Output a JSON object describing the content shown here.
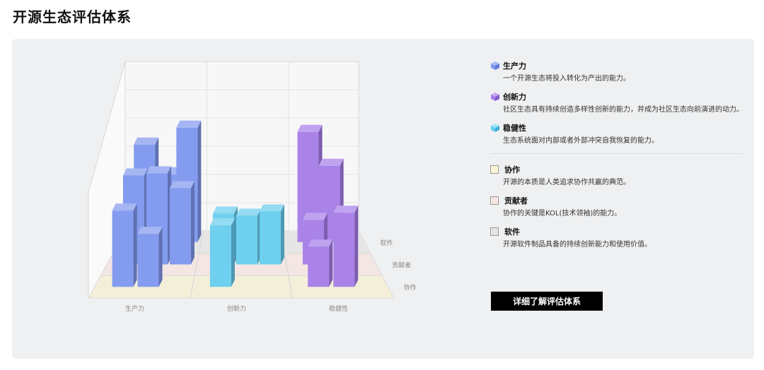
{
  "page": {
    "title": "开源生态评估体系"
  },
  "legend": {
    "dimensions": [
      {
        "label": "生产力",
        "desc": "一个开源生态将投入转化为产出的能力。",
        "color": "#7e97ee",
        "icon": "cube-icon"
      },
      {
        "label": "创新力",
        "desc": "社区生态具有持续创造多样性创新的能力，并成为社区生态向前演进的动力。",
        "color": "#a57ce8",
        "icon": "cube-icon"
      },
      {
        "label": "稳健性",
        "desc": "生态系统面对内部或者外部冲突自我恢复的能力。",
        "color": "#66ccee",
        "icon": "cube-icon"
      }
    ],
    "layers": [
      {
        "label": "协作",
        "desc": "开源的本质是人类追求协作共赢的典范。",
        "color": "#fbf3d6",
        "icon": "square-icon"
      },
      {
        "label": "贡献者",
        "desc": "协作的关键是KOL(技术领袖)的能力。",
        "color": "#f5e6e1",
        "icon": "square-icon"
      },
      {
        "label": "软件",
        "desc": "开源软件制品具备的持续创新能力和使用价值。",
        "color": "#e4e4e4",
        "icon": "square-icon"
      }
    ]
  },
  "cta": {
    "label": "详细了解评估体系"
  },
  "chart_data": {
    "type": "bar3d",
    "x_categories": [
      "生产力",
      "创新力",
      "稳健性"
    ],
    "depth_categories": [
      "协作",
      "贡献者",
      "软件"
    ],
    "colors": {
      "生产力": "#7e97ee",
      "创新力": "#66ccee",
      "稳健性": "#a57ce8"
    },
    "bars": [
      {
        "group": "生产力",
        "layer": "协作",
        "sub": 0,
        "value": 3.6
      },
      {
        "group": "生产力",
        "layer": "协作",
        "sub": 1,
        "value": 2.5
      },
      {
        "group": "生产力",
        "layer": "贡献者",
        "sub": 0,
        "value": 4.2
      },
      {
        "group": "生产力",
        "layer": "贡献者",
        "sub": 1,
        "value": 4.3
      },
      {
        "group": "生产力",
        "layer": "贡献者",
        "sub": 2,
        "value": 3.6
      },
      {
        "group": "生产力",
        "layer": "软件",
        "sub": 0,
        "value": 4.6
      },
      {
        "group": "生产力",
        "layer": "软件",
        "sub": 1,
        "value": 3.2
      },
      {
        "group": "生产力",
        "layer": "软件",
        "sub": 2,
        "value": 5.4
      },
      {
        "group": "创新力",
        "layer": "协作",
        "sub": 0,
        "value": 2.9
      },
      {
        "group": "创新力",
        "layer": "贡献者",
        "sub": 0,
        "value": 2.4
      },
      {
        "group": "创新力",
        "layer": "贡献者",
        "sub": 1,
        "value": 2.3
      },
      {
        "group": "创新力",
        "layer": "贡献者",
        "sub": 2,
        "value": 2.5
      },
      {
        "group": "稳健性",
        "layer": "协作",
        "sub": 0,
        "value": 1.9
      },
      {
        "group": "稳健性",
        "layer": "协作",
        "sub": 1,
        "value": 3.5
      },
      {
        "group": "稳健性",
        "layer": "贡献者",
        "sub": 0,
        "value": 2.1
      },
      {
        "group": "稳健性",
        "layer": "软件",
        "sub": 0,
        "value": 5.2
      },
      {
        "group": "稳健性",
        "layer": "软件",
        "sub": 1,
        "value": 3.6
      }
    ]
  }
}
